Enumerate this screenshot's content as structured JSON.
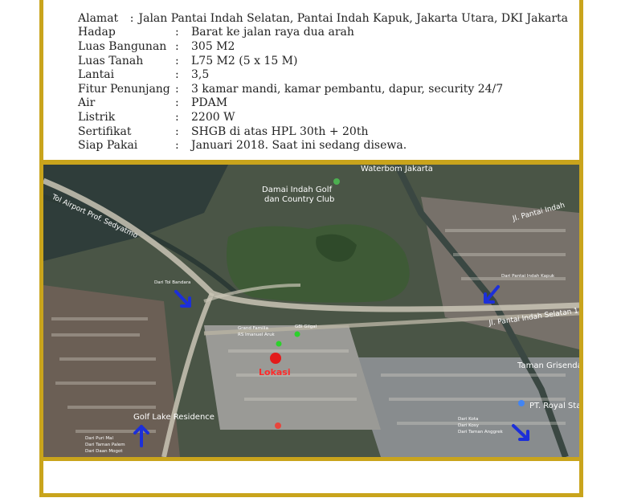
{
  "property": {
    "rows": [
      {
        "label": "Alamat",
        "value": "Jalan Pantai Indah Selatan, Pantai Indah Kapuk, Jakarta Utara, DKI Jakarta"
      },
      {
        "label": "Hadap",
        "value": "Barat ke jalan raya dua arah"
      },
      {
        "label": "Luas Bangunan",
        "value": "305 M2"
      },
      {
        "label": "Luas Tanah",
        "value": "L75 M2 (5 x 15 M)"
      },
      {
        "label": "Lantai",
        "value": "3,5"
      },
      {
        "label": "Fitur Penunjang",
        "value": "3 kamar mandi, kamar pembantu, dapur, security 24/7"
      },
      {
        "label": "Air",
        "value": "PDAM"
      },
      {
        "label": "Listrik",
        "value": "2200 W"
      },
      {
        "label": "Sertifikat",
        "value": "SHGB di atas HPL 30th + 20th"
      },
      {
        "label": "Siap Pakai",
        "value": "Januari 2018. Saat ini sedang disewa."
      }
    ],
    "separator": ":"
  },
  "map": {
    "places": {
      "golf": "Damai Indah Golf",
      "golf2": "dan Country Club",
      "waterbom": "Waterbom Jakarta",
      "toll": "Tol Airport Prof. Sedyatmo",
      "pantai_indah": "Jl. Pantai Indah",
      "pantai_selatan": "Jl. Pantai Indah Selatan 1",
      "grisenda": "Taman Grisenda",
      "royal": "PT. Royal Stand",
      "golf_lake": "Golf Lake Residence"
    },
    "annotations": {
      "dari_tol": "Dari Tol Bandara",
      "dari_pik": "Dari Pantai Indah Kapuk",
      "grand_familia": "Grand Familia",
      "rs": "RS Imanuel Aruk",
      "gbi": "GBI Gilgal",
      "lokasi": "Lokasi",
      "dari_kota_1": "Dari Kota",
      "dari_kota_2": "Dari Kosy",
      "dari_kota_3": "Dari Taman Anggrek",
      "dari_puri_1": "Dari Puri Mal",
      "dari_puri_2": "Dari Taman Palem",
      "dari_puri_3": "Dari Daan Mogot"
    },
    "colors": {
      "marker": "#e31b1b",
      "arrow": "#1c2fd9",
      "poi": "#2bd12b",
      "frame": "#c9a41c"
    }
  }
}
